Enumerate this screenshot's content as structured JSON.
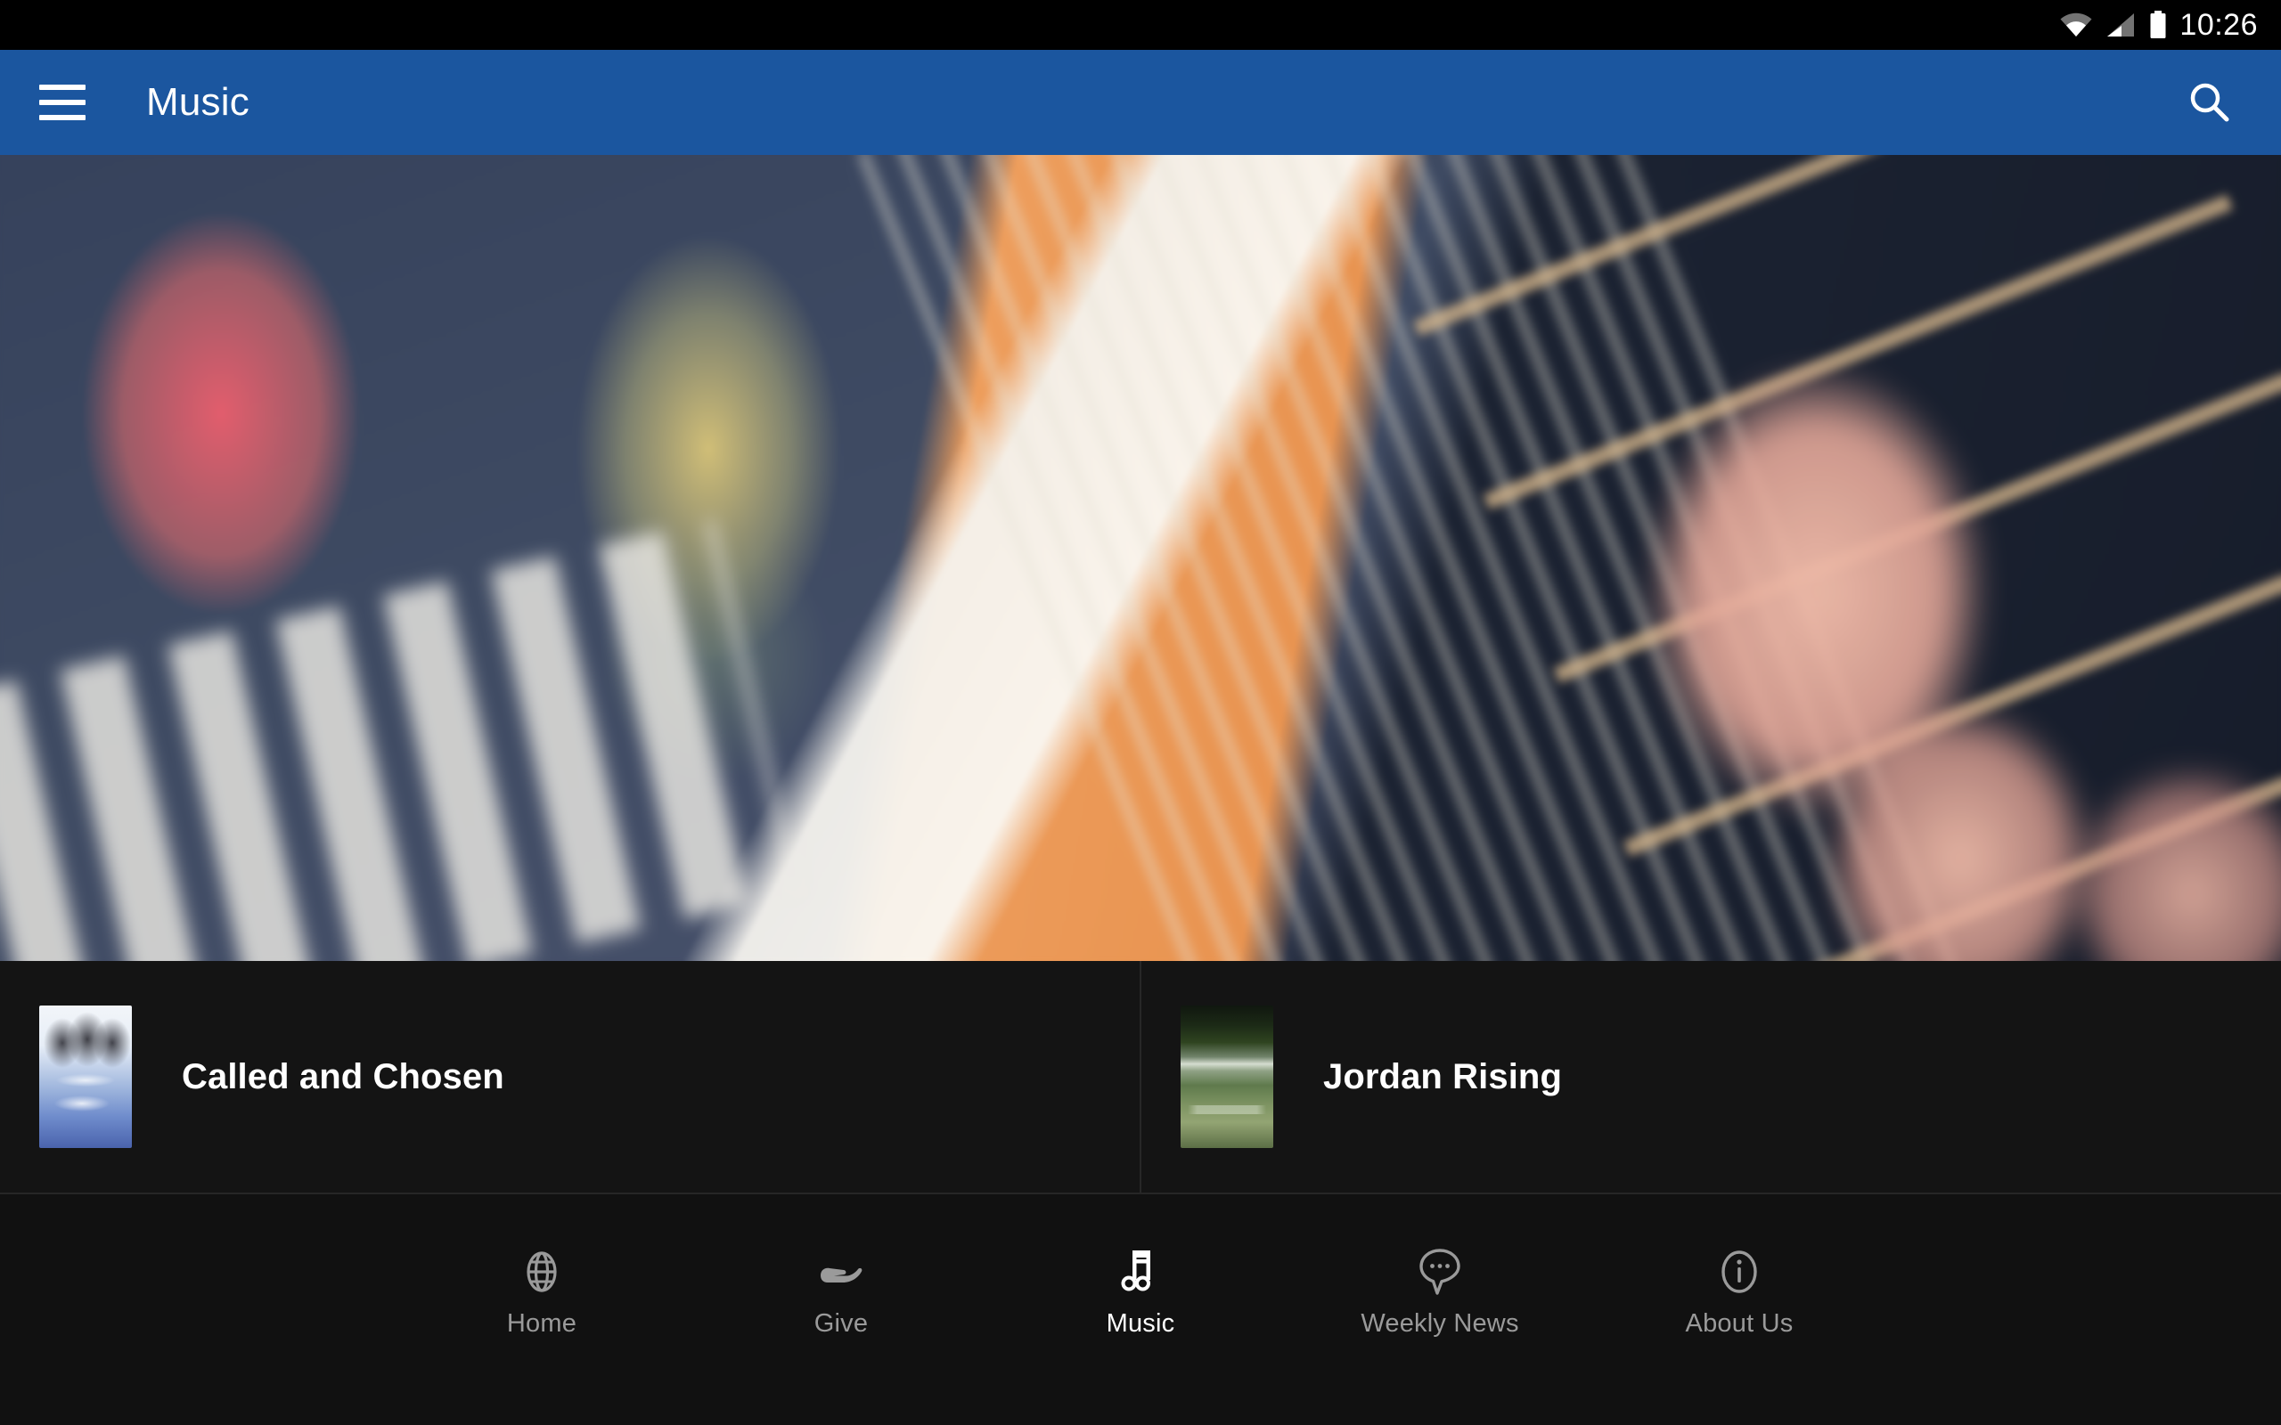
{
  "status_bar": {
    "time": "10:26",
    "icons": [
      "wifi-icon",
      "cellular-signal-icon",
      "battery-icon"
    ]
  },
  "app_bar": {
    "menu_icon": "hamburger-menu-icon",
    "title": "Music",
    "search_icon": "search-icon",
    "background_color": "#1B569F"
  },
  "hero": {
    "alt": "Blurred close-up photo of a hand playing an acoustic guitar fretboard with colorful bokeh lights and piano keys"
  },
  "music_list": {
    "items": [
      {
        "title": "Called and Chosen",
        "thumbnail": "album-art-called-and-chosen"
      },
      {
        "title": "Jordan Rising",
        "thumbnail": "album-art-jordan-rising"
      }
    ]
  },
  "bottom_nav": {
    "active_index": 2,
    "items": [
      {
        "label": "Home",
        "icon": "globe-icon"
      },
      {
        "label": "Give",
        "icon": "giving-hand-icon"
      },
      {
        "label": "Music",
        "icon": "music-note-icon"
      },
      {
        "label": "Weekly News",
        "icon": "chat-bubble-icon"
      },
      {
        "label": "About Us",
        "icon": "info-circle-icon"
      }
    ]
  },
  "colors": {
    "accent": "#1B569F",
    "background": "#111111",
    "list_background": "#141414",
    "divider": "#272727",
    "inactive_label": "#9A9A9A",
    "active_label": "#FFFFFF"
  }
}
